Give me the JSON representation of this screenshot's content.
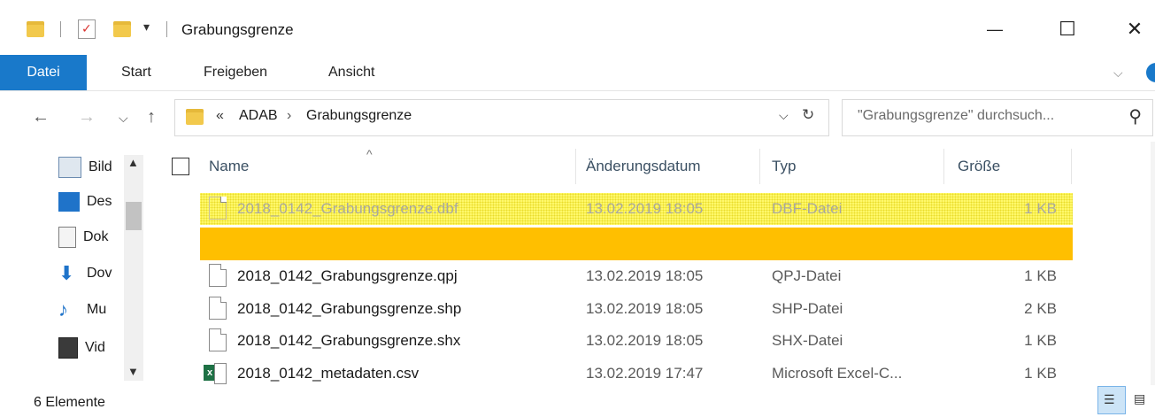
{
  "window": {
    "title": "Grabungsgrenze",
    "minimize_glyph": "—",
    "maximize_glyph": "☐",
    "close_glyph": "✕"
  },
  "ribbon": {
    "tabs": [
      "Datei",
      "Start",
      "Freigeben",
      "Ansicht"
    ]
  },
  "address": {
    "prefix": "«",
    "crumbs": [
      "ADAB",
      "Grabungsgrenze"
    ],
    "separator": "›"
  },
  "search": {
    "placeholder": "\"Grabungsgrenze\" durchsuch..."
  },
  "nav_pane": {
    "items": [
      "Bild",
      "Des",
      "Dok",
      "Dov",
      "Mu",
      "Vid"
    ]
  },
  "columns": {
    "name": "Name",
    "date": "Änderungsdatum",
    "type": "Typ",
    "size": "Größe"
  },
  "files": [
    {
      "name": "2018_0142_Grabungsgrenze.dbf",
      "date": "13.02.2019 18:05",
      "type": "DBF-Datei",
      "size": "1 KB"
    },
    {
      "name": "2018_0142_Grabungsgrenze.qpj",
      "date": "13.02.2019 18:05",
      "type": "QPJ-Datei",
      "size": "1 KB"
    },
    {
      "name": "2018_0142_Grabungsgrenze.shp",
      "date": "13.02.2019 18:05",
      "type": "SHP-Datei",
      "size": "2 KB"
    },
    {
      "name": "2018_0142_Grabungsgrenze.shx",
      "date": "13.02.2019 18:05",
      "type": "SHX-Datei",
      "size": "1 KB"
    },
    {
      "name": "2018_0142_metadaten.csv",
      "date": "13.02.2019 17:47",
      "type": "Microsoft Excel-C...",
      "size": "1 KB"
    }
  ],
  "status": {
    "count": "6 Elemente"
  },
  "colors": {
    "accent": "#1979ca",
    "highlight_yellow": "#fff86a",
    "highlight_orange": "#ffbf00"
  }
}
